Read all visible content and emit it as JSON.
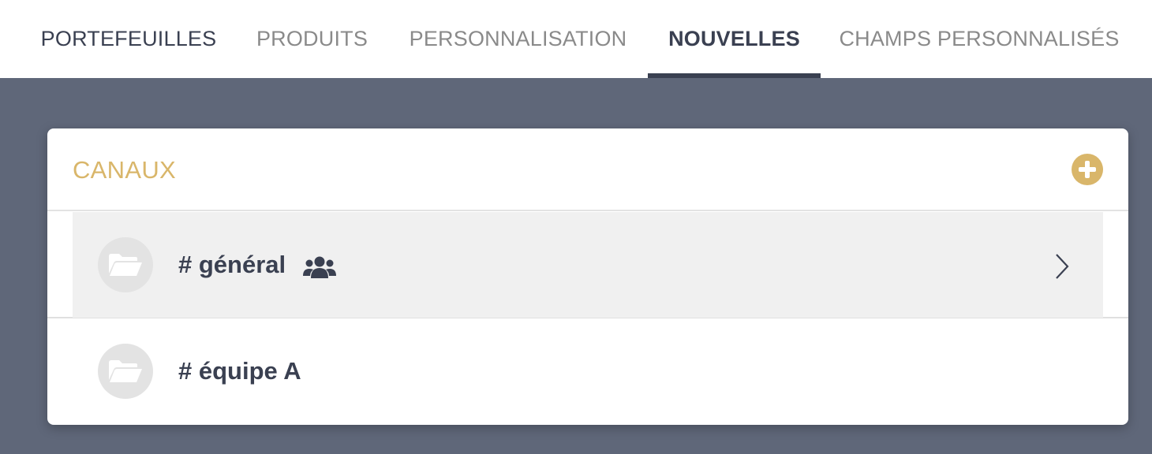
{
  "nav": {
    "tabs": [
      {
        "label": "PORTEFEUILLES",
        "active": false
      },
      {
        "label": "PRODUITS",
        "active": false
      },
      {
        "label": "PERSONNALISATION",
        "active": false
      },
      {
        "label": "NOUVELLES",
        "active": true
      },
      {
        "label": "CHAMPS PERSONNALISÉS",
        "active": false
      }
    ]
  },
  "channels": {
    "title": "CANAUX",
    "add_icon": "plus-circle-icon",
    "items": [
      {
        "name": "# général",
        "icon": "folder-open-icon",
        "group_icon": "users-icon",
        "highlighted": true,
        "chevron_icon": "chevron-right-icon"
      },
      {
        "name": "# équipe A",
        "icon": "folder-open-icon"
      }
    ]
  },
  "colors": {
    "accent": "#d9b66a",
    "text_dark": "#3a4051",
    "text_muted": "#8a8a8a",
    "background": "#5f6779",
    "row_highlight": "#f0f0f0"
  }
}
